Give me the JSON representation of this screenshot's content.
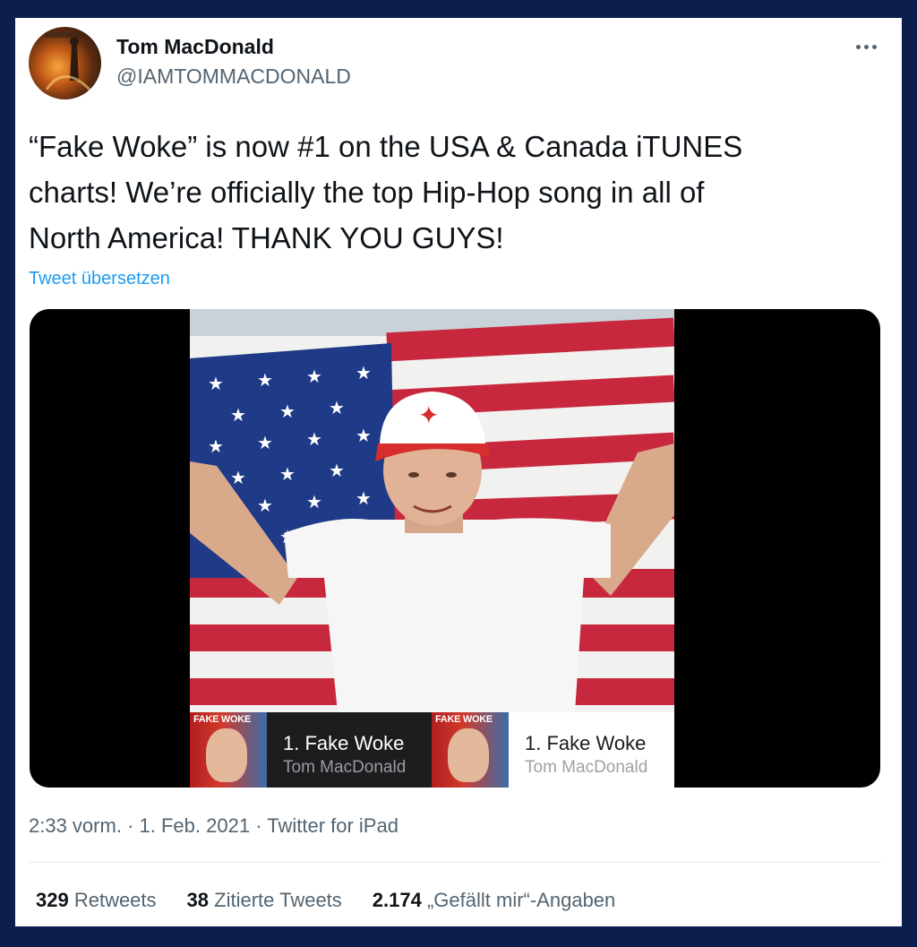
{
  "tweet": {
    "author_name": "Tom MacDonald",
    "author_handle": "@IAMTOMMACDONALD",
    "text": "“Fake Woke” is now #1 on the USA & Canada iTUNES\ncharts! We’re officially the top Hip-Hop song in all of\nNorth America! THANK YOU GUYS!",
    "translate_label": "Tweet übersetzen",
    "time": "2:33 vorm.",
    "date": "1. Feb. 2021",
    "source": "Twitter for iPad",
    "separator": "·"
  },
  "media": {
    "chart_entries": [
      {
        "cover_title": "FAKE WOKE",
        "song": "1. Fake Woke",
        "artist": "Tom MacDonald"
      },
      {
        "cover_title": "FAKE WOKE",
        "song": "1. Fake Woke",
        "artist": "Tom MacDonald"
      }
    ]
  },
  "stats": {
    "retweets_count": "329",
    "retweets_label": "Retweets",
    "quotes_count": "38",
    "quotes_label": "Zitierte Tweets",
    "likes_count": "2.174",
    "likes_label": "„Gefällt mir“-Angaben"
  },
  "icons": {
    "more": "more-horizontal-icon"
  },
  "colors": {
    "frame": "#0c1f4c",
    "link": "#1d9bf0",
    "muted": "#536471"
  }
}
